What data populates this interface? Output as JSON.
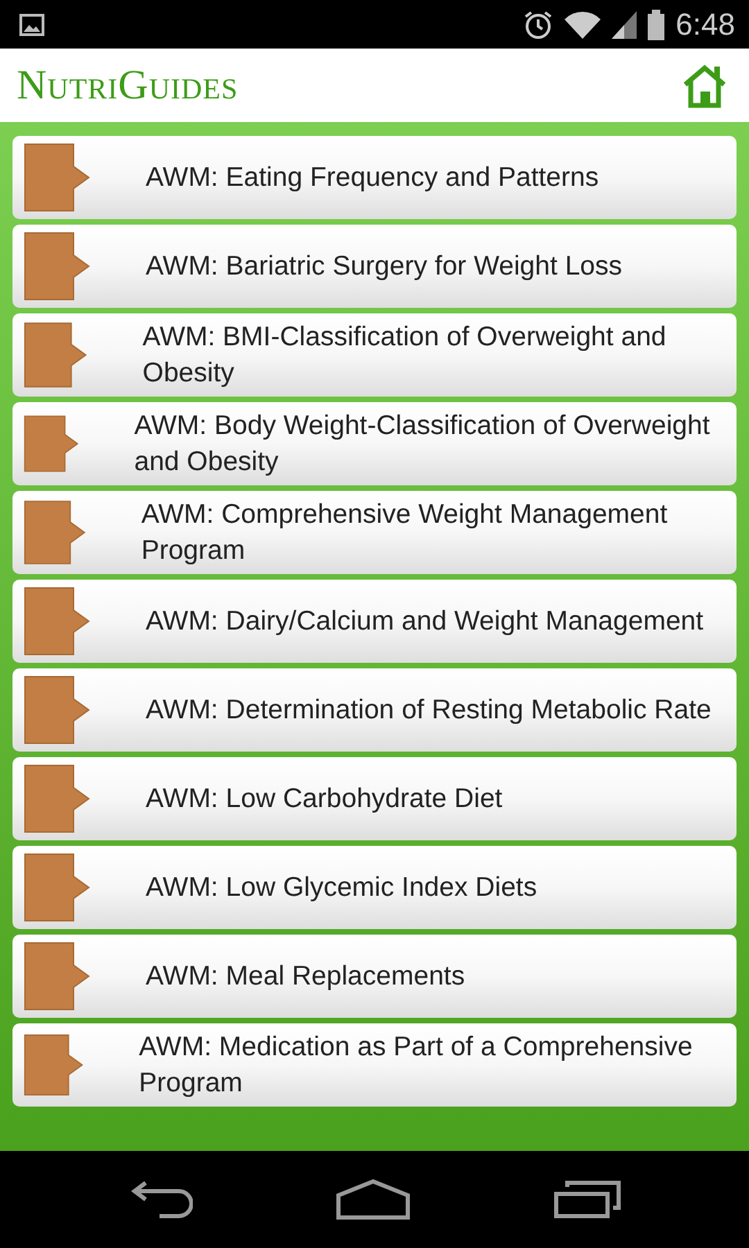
{
  "status_bar": {
    "time": "6:48"
  },
  "header": {
    "title": "NutriGuides"
  },
  "items": [
    {
      "label": "AWM:  Eating Frequency and Patterns"
    },
    {
      "label": "AWM: Bariatric Surgery for Weight Loss"
    },
    {
      "label": "AWM: BMI-Classification of Overweight and Obesity"
    },
    {
      "label": "AWM: Body Weight-Classification of Overweight and Obesity"
    },
    {
      "label": "AWM: Comprehensive Weight Management Program"
    },
    {
      "label": "AWM: Dairy/Calcium and Weight Management"
    },
    {
      "label": "AWM: Determination of Resting Metabolic Rate"
    },
    {
      "label": "AWM: Low Carbohydrate Diet"
    },
    {
      "label": "AWM: Low Glycemic Index Diets"
    },
    {
      "label": "AWM: Meal Replacements"
    },
    {
      "label": "AWM: Medication as Part of a Comprehensive Program"
    }
  ]
}
